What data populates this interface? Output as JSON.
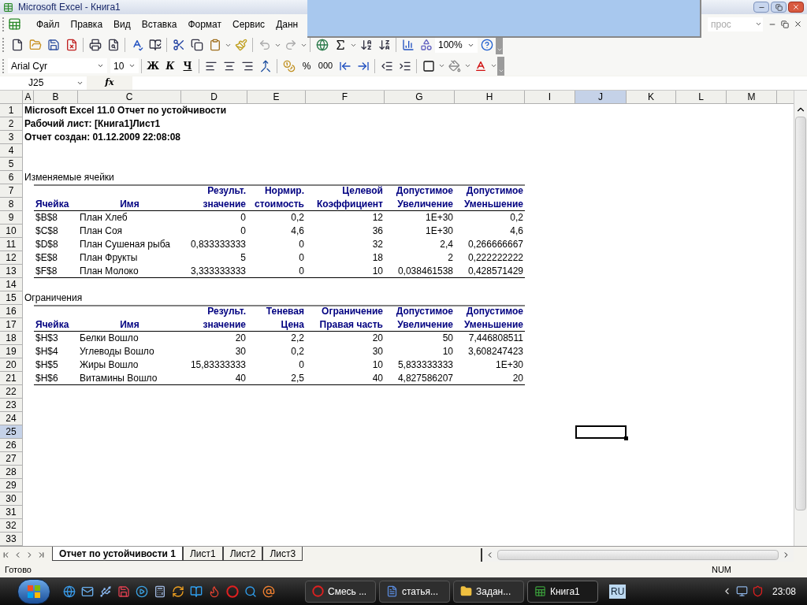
{
  "window": {
    "title": "Microsoft Excel - Книга1"
  },
  "menu": [
    "Файл",
    "Правка",
    "Вид",
    "Вставка",
    "Формат",
    "Сервис",
    "Данн"
  ],
  "help_search": {
    "placeholder": "прос"
  },
  "toolbar": {
    "zoom": "100%"
  },
  "formatting": {
    "font": "Arial Cyr",
    "size": "10",
    "bold": "Ж",
    "italic": "К",
    "underline": "Ч",
    "percent": "%",
    "thousands": "000"
  },
  "formula_bar": {
    "name_box": "J25",
    "fx": "fx"
  },
  "sheet": {
    "columns": [
      {
        "label": "A",
        "selected": false
      },
      {
        "label": "B",
        "selected": false
      },
      {
        "label": "C",
        "selected": false
      },
      {
        "label": "D",
        "selected": false
      },
      {
        "label": "E",
        "selected": false
      },
      {
        "label": "F",
        "selected": false
      },
      {
        "label": "G",
        "selected": false
      },
      {
        "label": "H",
        "selected": false
      },
      {
        "label": "I",
        "selected": false
      },
      {
        "label": "J",
        "selected": true
      },
      {
        "label": "K",
        "selected": false
      },
      {
        "label": "L",
        "selected": false
      },
      {
        "label": "M",
        "selected": false
      }
    ],
    "rows": [
      {
        "n": "1",
        "kind": "title",
        "selected": false,
        "cells": [
          "Microsoft Excel 11.0 Отчет по устойчивости"
        ]
      },
      {
        "n": "2",
        "kind": "title",
        "selected": false,
        "cells": [
          "Рабочий лист: [Книга1]Лист1"
        ]
      },
      {
        "n": "3",
        "kind": "title",
        "selected": false,
        "cells": [
          "Отчет создан: 01.12.2009 22:08:08"
        ]
      },
      {
        "n": "4",
        "kind": "empty",
        "selected": false
      },
      {
        "n": "5",
        "kind": "empty",
        "selected": false
      },
      {
        "n": "6",
        "kind": "section",
        "selected": false,
        "cells": [
          "Изменяемые ячейки"
        ]
      },
      {
        "n": "7",
        "kind": "header_top",
        "selected": false,
        "cells": [
          "",
          "",
          "",
          "Результ.",
          "Нормир.",
          "Целевой",
          "Допустимое",
          "Допустимое"
        ]
      },
      {
        "n": "8",
        "kind": "header_bottom",
        "selected": false,
        "cells": [
          "",
          "Ячейка",
          "Имя",
          "значение",
          "стоимость",
          "Коэффициент",
          "Увеличение",
          "Уменьшение"
        ]
      },
      {
        "n": "9",
        "kind": "data",
        "selected": false,
        "cells": [
          "",
          "$B$8",
          "План Хлеб",
          "0",
          "0,2",
          "12",
          "1E+30",
          "0,2"
        ]
      },
      {
        "n": "10",
        "kind": "data",
        "selected": false,
        "cells": [
          "",
          "$C$8",
          "План Соя",
          "0",
          "4,6",
          "36",
          "1E+30",
          "4,6"
        ]
      },
      {
        "n": "11",
        "kind": "data",
        "selected": false,
        "cells": [
          "",
          "$D$8",
          "План Сушеная рыба",
          "0,833333333",
          "0",
          "32",
          "2,4",
          "0,266666667"
        ]
      },
      {
        "n": "12",
        "kind": "data",
        "selected": false,
        "cells": [
          "",
          "$E$8",
          "План Фрукты",
          "5",
          "0",
          "18",
          "2",
          "0,222222222"
        ]
      },
      {
        "n": "13",
        "kind": "last",
        "selected": false,
        "cells": [
          "",
          "$F$8",
          "План Молоко",
          "3,333333333",
          "0",
          "10",
          "0,038461538",
          "0,428571429"
        ]
      },
      {
        "n": "14",
        "kind": "empty",
        "selected": false
      },
      {
        "n": "15",
        "kind": "section",
        "selected": false,
        "cells": [
          "Ограничения"
        ]
      },
      {
        "n": "16",
        "kind": "header_top",
        "selected": false,
        "cells": [
          "",
          "",
          "",
          "Результ.",
          "Теневая",
          "Ограничение",
          "Допустимое",
          "Допустимое"
        ]
      },
      {
        "n": "17",
        "kind": "header_bottom",
        "selected": false,
        "cells": [
          "",
          "Ячейка",
          "Имя",
          "значение",
          "Цена",
          "Правая часть",
          "Увеличение",
          "Уменьшение"
        ]
      },
      {
        "n": "18",
        "kind": "data",
        "selected": false,
        "cells": [
          "",
          "$H$3",
          "Белки Вошло",
          "20",
          "2,2",
          "20",
          "50",
          "7,446808511"
        ]
      },
      {
        "n": "19",
        "kind": "data",
        "selected": false,
        "cells": [
          "",
          "$H$4",
          "Углеводы Вошло",
          "30",
          "0,2",
          "30",
          "10",
          "3,608247423"
        ]
      },
      {
        "n": "20",
        "kind": "data",
        "selected": false,
        "cells": [
          "",
          "$H$5",
          "Жиры Вошло",
          "15,83333333",
          "0",
          "10",
          "5,833333333",
          "1E+30"
        ]
      },
      {
        "n": "21",
        "kind": "last",
        "selected": false,
        "cells": [
          "",
          "$H$6",
          "Витамины Вошло",
          "40",
          "2,5",
          "40",
          "4,827586207",
          "20"
        ]
      },
      {
        "n": "22",
        "kind": "empty",
        "selected": false
      },
      {
        "n": "23",
        "kind": "empty",
        "selected": false
      },
      {
        "n": "24",
        "kind": "empty",
        "selected": false
      },
      {
        "n": "25",
        "kind": "empty",
        "selected": true
      },
      {
        "n": "26",
        "kind": "empty",
        "selected": false
      },
      {
        "n": "27",
        "kind": "empty",
        "selected": false
      },
      {
        "n": "28",
        "kind": "empty",
        "selected": false
      },
      {
        "n": "29",
        "kind": "empty",
        "selected": false
      },
      {
        "n": "30",
        "kind": "empty",
        "selected": false
      },
      {
        "n": "31",
        "kind": "empty",
        "selected": false
      },
      {
        "n": "32",
        "kind": "empty",
        "selected": false
      },
      {
        "n": "33",
        "kind": "empty",
        "selected": false
      }
    ]
  },
  "sheet_tabs": [
    {
      "label": "Отчет по устойчивости 1",
      "selected": true
    },
    {
      "label": "Лист1",
      "selected": false
    },
    {
      "label": "Лист2",
      "selected": false
    },
    {
      "label": "Лист3",
      "selected": false
    }
  ],
  "status_bar": {
    "text": "Готово",
    "num": "NUM"
  },
  "taskbar": {
    "tasks": [
      {
        "label": "Смесь ...",
        "kind": "browser",
        "selected": false
      },
      {
        "label": "статья...",
        "kind": "document",
        "selected": false
      },
      {
        "label": "Задан...",
        "kind": "folder",
        "selected": false
      },
      {
        "label": "Книга1",
        "kind": "spreadsheet",
        "selected": true
      }
    ],
    "language": "RU",
    "clock": "23:08"
  }
}
